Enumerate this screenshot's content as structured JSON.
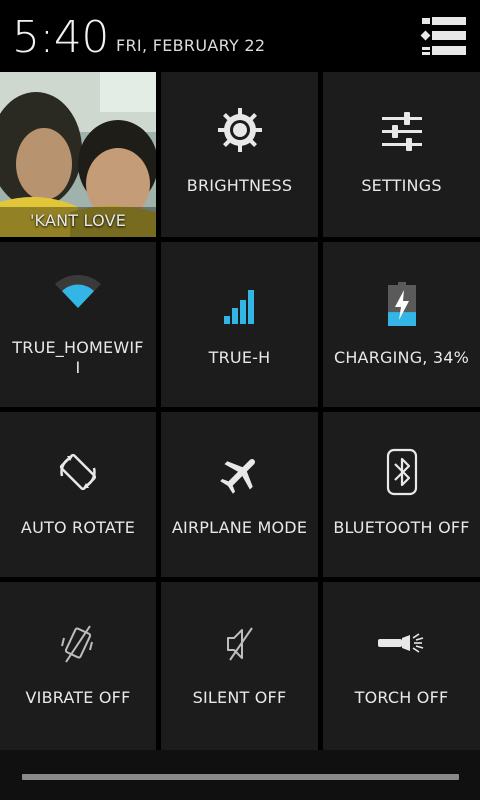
{
  "header": {
    "time": "5:40",
    "date": "FRI, FEBRUARY 22",
    "toggle_icon": "list-toggle-icon"
  },
  "tiles": [
    {
      "name": "user",
      "label": "'KANT LOVE",
      "icon": "profile-photo"
    },
    {
      "name": "brightness",
      "label": "BRIGHTNESS",
      "icon": "brightness-icon"
    },
    {
      "name": "settings",
      "label": "SETTINGS",
      "icon": "settings-sliders-icon"
    },
    {
      "name": "wifi",
      "label": "TRUE_HOMEWIFI",
      "label_line1": "TRUE_HOMEWIF",
      "label_line2": "I",
      "icon": "wifi-icon"
    },
    {
      "name": "mobile-data",
      "label": "TRUE-H",
      "icon": "signal-bars-icon"
    },
    {
      "name": "battery",
      "label": "CHARGING, 34%",
      "icon": "battery-charging-icon",
      "level": 0.34
    },
    {
      "name": "auto-rotate",
      "label": "AUTO ROTATE",
      "icon": "rotate-icon"
    },
    {
      "name": "airplane-mode",
      "label": "AIRPLANE MODE",
      "icon": "airplane-icon"
    },
    {
      "name": "bluetooth",
      "label": "BLUETOOTH OFF",
      "icon": "bluetooth-icon"
    },
    {
      "name": "vibrate",
      "label": "VIBRATE OFF",
      "icon": "vibrate-icon"
    },
    {
      "name": "silent",
      "label": "SILENT OFF",
      "icon": "silent-icon"
    },
    {
      "name": "torch",
      "label": "TORCH OFF",
      "icon": "torch-icon"
    }
  ],
  "colors": {
    "accent": "#33b5e5",
    "tile_bg": "#1c1c1c",
    "background": "#000000",
    "text": "#e8e8e8"
  }
}
